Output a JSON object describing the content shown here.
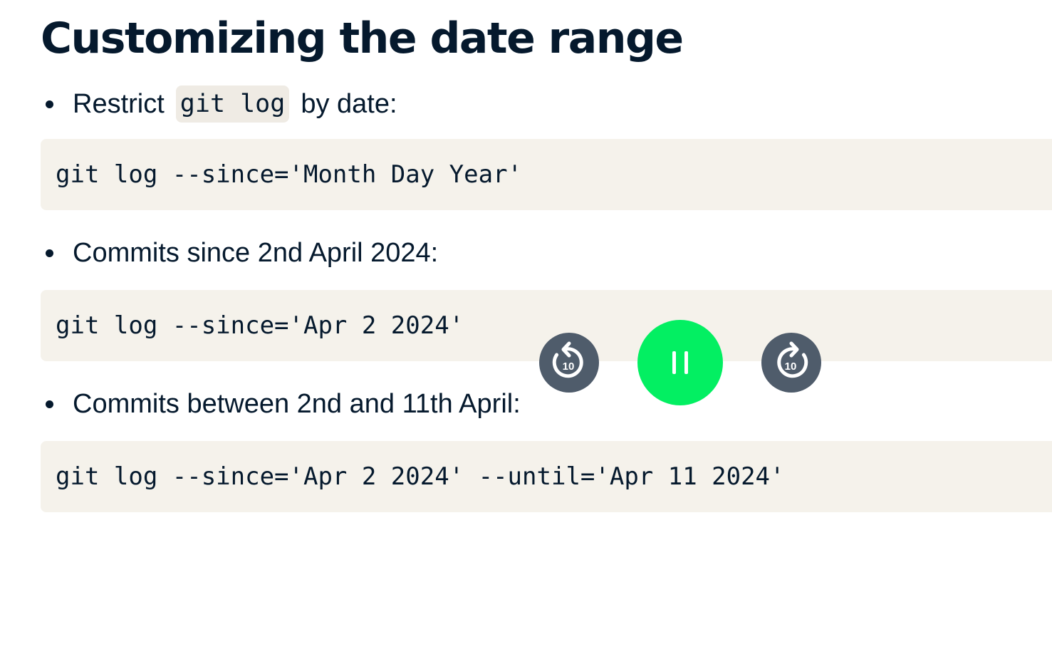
{
  "slide": {
    "title": "Customizing the date range",
    "bullets": [
      {
        "before": "Restrict",
        "code": "git log",
        "after": "by date:",
        "block": "git log --since='Month Day Year'"
      },
      {
        "text": "Commits since 2nd April 2024:",
        "block": "git log --since='Apr 2 2024'"
      },
      {
        "text": "Commits between 2nd and 11th April:",
        "block": "git log --since='Apr 2 2024' --until='Apr 11 2024'"
      }
    ]
  },
  "player": {
    "rewind_seconds": "10",
    "forward_seconds": "10",
    "state": "playing",
    "icons": {
      "rewind": "rewind-10-icon",
      "pause": "pause-icon",
      "forward": "forward-10-icon"
    },
    "colors": {
      "play": "#03ef62",
      "skip": "#4f5c6b"
    }
  },
  "colors": {
    "text": "#05192d",
    "code_block_bg": "#f5f2eb",
    "inline_code_bg": "#efebe4"
  }
}
